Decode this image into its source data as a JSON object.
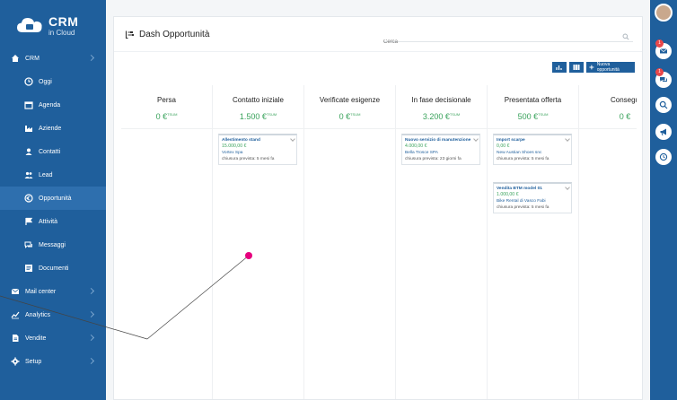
{
  "app": {
    "logo_title": "CRM",
    "logo_sub": "in Cloud"
  },
  "sidebar": {
    "items": [
      {
        "label": "CRM",
        "icon": "home-icon",
        "level": "top"
      },
      {
        "label": "Oggi",
        "icon": "clock-icon",
        "level": "sub"
      },
      {
        "label": "Agenda",
        "icon": "calendar-icon",
        "level": "sub"
      },
      {
        "label": "Aziende",
        "icon": "factory-icon",
        "level": "sub"
      },
      {
        "label": "Contatti",
        "icon": "contact-icon",
        "level": "sub"
      },
      {
        "label": "Lead",
        "icon": "users-icon",
        "level": "sub"
      },
      {
        "label": "Opportunità",
        "icon": "euro-icon",
        "level": "sub",
        "active": true
      },
      {
        "label": "Attività",
        "icon": "flag-icon",
        "level": "sub"
      },
      {
        "label": "Messaggi",
        "icon": "chat-icon",
        "level": "sub"
      },
      {
        "label": "Documenti",
        "icon": "documents-icon",
        "level": "sub"
      },
      {
        "label": "Mail center",
        "icon": "mail-icon",
        "level": "top"
      },
      {
        "label": "Analytics",
        "icon": "chart-icon",
        "level": "top"
      },
      {
        "label": "Vendite",
        "icon": "document-icon",
        "level": "top"
      },
      {
        "label": "Setup",
        "icon": "gear-icon",
        "level": "top"
      }
    ]
  },
  "header": {
    "title": "Dash Opportunità",
    "search_placeholder": "Cerca"
  },
  "toolbar": {
    "new_label": "Nuova opportunità"
  },
  "board": {
    "columns": [
      {
        "name": "Persa",
        "total": "0 €",
        "sup": "TSUM",
        "cards": []
      },
      {
        "name": "Contatto iniziale",
        "total": "1.500 €",
        "sup": "TSUM",
        "cards": [
          {
            "name": "Allestimento stand",
            "amount": "15.000,00 €",
            "company": "Vortex Spa",
            "closing": "chiusura prevista: 5 mesi fa"
          }
        ]
      },
      {
        "name": "Verificate esigenze",
        "total": "0 €",
        "sup": "TSUM",
        "cards": []
      },
      {
        "name": "In fase decisionale",
        "total": "3.200 €",
        "sup": "TSUM",
        "cards": [
          {
            "name": "Nuovo servizio di manutenzione",
            "amount": "4.000,00 €",
            "company": "Bella Trosce SPA",
            "closing": "chiusura prevista: 23 giorni fa"
          }
        ]
      },
      {
        "name": "Presentata offerta",
        "total": "500 €",
        "sup": "TSUM",
        "cards": [
          {
            "name": "Import scarpe",
            "amount": "0,00 €",
            "company": "New Austian Shoes snc",
            "closing": "chiusura prevista: 5 mesi fa"
          },
          {
            "name": "Vendita BTM model 01",
            "amount": "1.000,00 €",
            "company": "Bike Rental di Vasco Fabi",
            "closing": "chiusura prevista: 5 mesi fa"
          }
        ]
      },
      {
        "name": "Consegu",
        "total": "0 €",
        "sup": "",
        "cards": []
      }
    ]
  },
  "rightbar": {
    "badges": [
      "1",
      "1"
    ]
  },
  "colors": {
    "primary": "#1f5f9c",
    "active": "#2e6fae",
    "amount_green": "#3aa35c",
    "annotation": "#e6007e"
  }
}
